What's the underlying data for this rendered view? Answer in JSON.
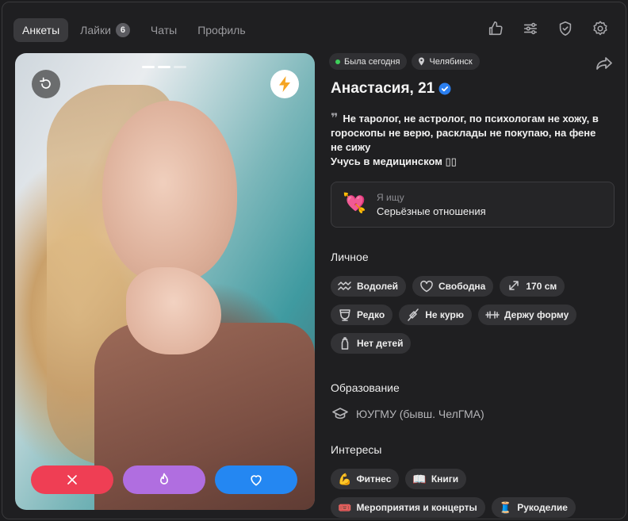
{
  "nav": {
    "tabs": [
      {
        "label": "Анкеты",
        "active": true
      },
      {
        "label": "Лайки",
        "badge": "6"
      },
      {
        "label": "Чаты"
      },
      {
        "label": "Профиль"
      }
    ],
    "icons": [
      "thumbs-up-icon",
      "filters-icon",
      "shield-check-icon",
      "gear-icon"
    ]
  },
  "photo": {
    "indicator_count": 3,
    "active_index": 1,
    "buttons": {
      "undo_icon": "undo-icon",
      "boost_icon": "lightning-icon",
      "nope_icon": "close-icon",
      "super_icon": "flame-icon",
      "like_icon": "heart-icon"
    },
    "colors": {
      "nope": "#ef3e54",
      "super": "#b06ee0",
      "like": "#2487f2",
      "boost": "#f5a524"
    }
  },
  "profile": {
    "status": "Была сегодня",
    "city": "Челябинск",
    "name": "Анастасия, 21",
    "verified": true,
    "bio_line1": "Не таролог, не астролог, по психологам не хожу, в гороскопы не верю, расклады не покупаю, на фене не сижу",
    "bio_line2": "Учусь в медицинском ▯▯",
    "seeking": {
      "emoji": "💘",
      "label": "Я ищу",
      "value": "Серьёзные отношения"
    }
  },
  "personal": {
    "title": "Личное",
    "tags": [
      {
        "icon": "aquarius-icon",
        "label": "Водолей"
      },
      {
        "icon": "heart-outline-icon",
        "label": "Свободна"
      },
      {
        "icon": "height-icon",
        "label": "170 см"
      },
      {
        "icon": "glass-icon",
        "label": "Редко"
      },
      {
        "icon": "no-smoking-icon",
        "label": "Не курю"
      },
      {
        "icon": "dumbbell-icon",
        "label": "Держу форму"
      },
      {
        "icon": "baby-bottle-icon",
        "label": "Нет детей"
      }
    ]
  },
  "education": {
    "title": "Образование",
    "value": "ЮУГМУ (бывш. ЧелГМА)"
  },
  "interests": {
    "title": "Интересы",
    "tags": [
      {
        "emoji": "💪",
        "label": "Фитнес"
      },
      {
        "emoji": "📖",
        "label": "Книги"
      },
      {
        "emoji": "🎟️",
        "label": "Мероприятия и концерты"
      },
      {
        "emoji": "🧵",
        "label": "Рукоделие"
      }
    ]
  }
}
